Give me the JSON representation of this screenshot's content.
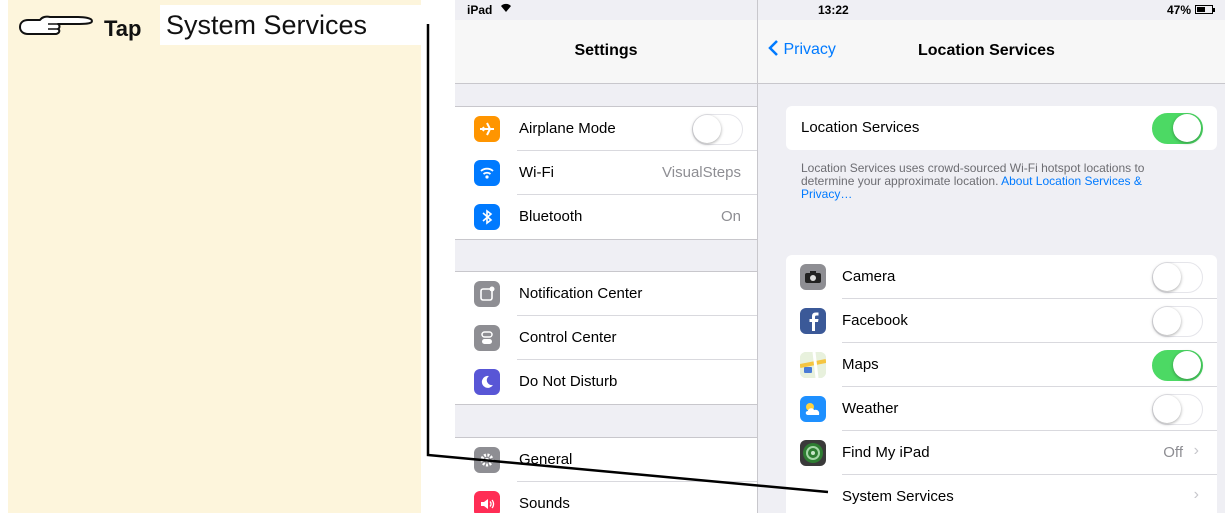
{
  "instruction": {
    "verb": "Tap",
    "target": "System Services"
  },
  "status_bar": {
    "carrier": "iPad",
    "time": "13:22",
    "battery": "47%"
  },
  "settings": {
    "title": "Settings",
    "groups": [
      [
        {
          "label": "Airplane Mode",
          "icon": "airplane-icon",
          "toggle": false
        },
        {
          "label": "Wi-Fi",
          "icon": "wifi-icon",
          "value": "VisualSteps"
        },
        {
          "label": "Bluetooth",
          "icon": "bluetooth-icon",
          "value": "On"
        }
      ],
      [
        {
          "label": "Notification Center",
          "icon": "notification-center-icon"
        },
        {
          "label": "Control Center",
          "icon": "control-center-icon"
        },
        {
          "label": "Do Not Disturb",
          "icon": "moon-icon"
        }
      ],
      [
        {
          "label": "General",
          "icon": "gear-icon"
        },
        {
          "label": "Sounds",
          "icon": "speaker-icon"
        }
      ]
    ]
  },
  "location": {
    "back_label": "Privacy",
    "title": "Location Services",
    "main_label": "Location Services",
    "main_on": true,
    "footnote": "Location Services uses crowd-sourced Wi-Fi hotspot locations to determine your approximate location.",
    "footnote_link": "About Location Services & Privacy…",
    "apps": [
      {
        "label": "Camera",
        "icon": "camera-icon",
        "toggle": false
      },
      {
        "label": "Facebook",
        "icon": "facebook-icon",
        "toggle": false
      },
      {
        "label": "Maps",
        "icon": "maps-icon",
        "toggle": true
      },
      {
        "label": "Weather",
        "icon": "weather-icon",
        "toggle": false
      },
      {
        "label": "Find My iPad",
        "icon": "find-my-ipad-icon",
        "value": "Off"
      },
      {
        "label": "System Services",
        "icon": ""
      }
    ]
  },
  "colors": {
    "accent": "#007aff",
    "toggle_on": "#4cd964",
    "instruction_bg": "#fdf5dc"
  }
}
